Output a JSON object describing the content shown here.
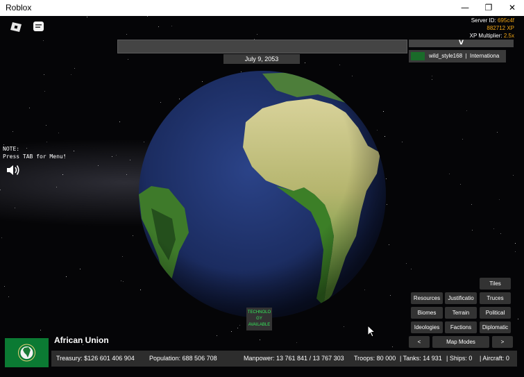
{
  "window": {
    "title": "Roblox",
    "minimize": "—",
    "maximize": "❐",
    "close": "✕"
  },
  "stats": {
    "server_label": "Server ID:",
    "server_id": "695c4f",
    "xp": "882712 XP",
    "mult_label": "XP Multiplier:",
    "mult": "2.5x"
  },
  "date": "July 9, 2053",
  "v_label": "V",
  "player": {
    "name": "wild_style168",
    "sep": "|",
    "faction": "Internationa"
  },
  "note": "NOTE:\nPress TAB for Menu!",
  "tech": "TECHNOLO\nGY\nAVAILABLE",
  "map_buttons": {
    "tiles": "Tiles",
    "resources": "Resources",
    "justification": "Justificatio",
    "truces": "Truces",
    "biomes": "Biomes",
    "terrain": "Terrain",
    "political": "Political",
    "ideologies": "Ideologies",
    "factions": "Factions",
    "diplomatic": "Diplomatic",
    "prev": "<",
    "modes": "Map Modes",
    "next": ">"
  },
  "country": "African Union",
  "bottom": {
    "treasury": "Treasury:  $126 601 406 904",
    "population": "Population: 688 506 708",
    "manpower": "Manpower:  13 761 841  /  13 767 303",
    "troops": "Troops: 80 000",
    "tanks": "|  Tanks: 14 931",
    "ships": "|  Ships: 0",
    "aircraft": "|  Aircraft: 0"
  },
  "colors": {
    "xp_accent": "#f2a614",
    "tech_text": "#35e85b",
    "ocean": "#1d2f63",
    "land": "#3f8a2c"
  }
}
